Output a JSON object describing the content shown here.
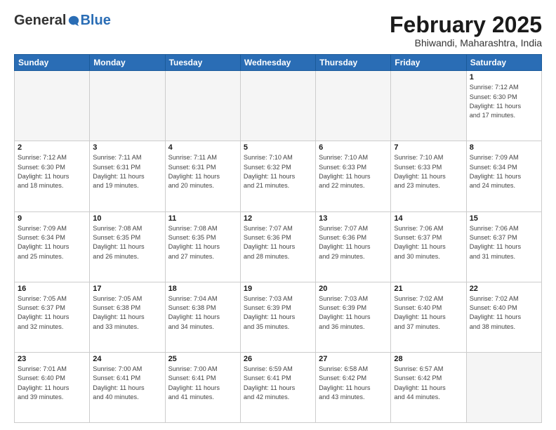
{
  "header": {
    "logo_general": "General",
    "logo_blue": "Blue",
    "title": "February 2025",
    "subtitle": "Bhiwandi, Maharashtra, India"
  },
  "weekdays": [
    "Sunday",
    "Monday",
    "Tuesday",
    "Wednesday",
    "Thursday",
    "Friday",
    "Saturday"
  ],
  "weeks": [
    [
      {
        "day": "",
        "info": ""
      },
      {
        "day": "",
        "info": ""
      },
      {
        "day": "",
        "info": ""
      },
      {
        "day": "",
        "info": ""
      },
      {
        "day": "",
        "info": ""
      },
      {
        "day": "",
        "info": ""
      },
      {
        "day": "1",
        "info": "Sunrise: 7:12 AM\nSunset: 6:30 PM\nDaylight: 11 hours\nand 17 minutes."
      }
    ],
    [
      {
        "day": "2",
        "info": "Sunrise: 7:12 AM\nSunset: 6:30 PM\nDaylight: 11 hours\nand 18 minutes."
      },
      {
        "day": "3",
        "info": "Sunrise: 7:11 AM\nSunset: 6:31 PM\nDaylight: 11 hours\nand 19 minutes."
      },
      {
        "day": "4",
        "info": "Sunrise: 7:11 AM\nSunset: 6:31 PM\nDaylight: 11 hours\nand 20 minutes."
      },
      {
        "day": "5",
        "info": "Sunrise: 7:10 AM\nSunset: 6:32 PM\nDaylight: 11 hours\nand 21 minutes."
      },
      {
        "day": "6",
        "info": "Sunrise: 7:10 AM\nSunset: 6:33 PM\nDaylight: 11 hours\nand 22 minutes."
      },
      {
        "day": "7",
        "info": "Sunrise: 7:10 AM\nSunset: 6:33 PM\nDaylight: 11 hours\nand 23 minutes."
      },
      {
        "day": "8",
        "info": "Sunrise: 7:09 AM\nSunset: 6:34 PM\nDaylight: 11 hours\nand 24 minutes."
      }
    ],
    [
      {
        "day": "9",
        "info": "Sunrise: 7:09 AM\nSunset: 6:34 PM\nDaylight: 11 hours\nand 25 minutes."
      },
      {
        "day": "10",
        "info": "Sunrise: 7:08 AM\nSunset: 6:35 PM\nDaylight: 11 hours\nand 26 minutes."
      },
      {
        "day": "11",
        "info": "Sunrise: 7:08 AM\nSunset: 6:35 PM\nDaylight: 11 hours\nand 27 minutes."
      },
      {
        "day": "12",
        "info": "Sunrise: 7:07 AM\nSunset: 6:36 PM\nDaylight: 11 hours\nand 28 minutes."
      },
      {
        "day": "13",
        "info": "Sunrise: 7:07 AM\nSunset: 6:36 PM\nDaylight: 11 hours\nand 29 minutes."
      },
      {
        "day": "14",
        "info": "Sunrise: 7:06 AM\nSunset: 6:37 PM\nDaylight: 11 hours\nand 30 minutes."
      },
      {
        "day": "15",
        "info": "Sunrise: 7:06 AM\nSunset: 6:37 PM\nDaylight: 11 hours\nand 31 minutes."
      }
    ],
    [
      {
        "day": "16",
        "info": "Sunrise: 7:05 AM\nSunset: 6:37 PM\nDaylight: 11 hours\nand 32 minutes."
      },
      {
        "day": "17",
        "info": "Sunrise: 7:05 AM\nSunset: 6:38 PM\nDaylight: 11 hours\nand 33 minutes."
      },
      {
        "day": "18",
        "info": "Sunrise: 7:04 AM\nSunset: 6:38 PM\nDaylight: 11 hours\nand 34 minutes."
      },
      {
        "day": "19",
        "info": "Sunrise: 7:03 AM\nSunset: 6:39 PM\nDaylight: 11 hours\nand 35 minutes."
      },
      {
        "day": "20",
        "info": "Sunrise: 7:03 AM\nSunset: 6:39 PM\nDaylight: 11 hours\nand 36 minutes."
      },
      {
        "day": "21",
        "info": "Sunrise: 7:02 AM\nSunset: 6:40 PM\nDaylight: 11 hours\nand 37 minutes."
      },
      {
        "day": "22",
        "info": "Sunrise: 7:02 AM\nSunset: 6:40 PM\nDaylight: 11 hours\nand 38 minutes."
      }
    ],
    [
      {
        "day": "23",
        "info": "Sunrise: 7:01 AM\nSunset: 6:40 PM\nDaylight: 11 hours\nand 39 minutes."
      },
      {
        "day": "24",
        "info": "Sunrise: 7:00 AM\nSunset: 6:41 PM\nDaylight: 11 hours\nand 40 minutes."
      },
      {
        "day": "25",
        "info": "Sunrise: 7:00 AM\nSunset: 6:41 PM\nDaylight: 11 hours\nand 41 minutes."
      },
      {
        "day": "26",
        "info": "Sunrise: 6:59 AM\nSunset: 6:41 PM\nDaylight: 11 hours\nand 42 minutes."
      },
      {
        "day": "27",
        "info": "Sunrise: 6:58 AM\nSunset: 6:42 PM\nDaylight: 11 hours\nand 43 minutes."
      },
      {
        "day": "28",
        "info": "Sunrise: 6:57 AM\nSunset: 6:42 PM\nDaylight: 11 hours\nand 44 minutes."
      },
      {
        "day": "",
        "info": ""
      }
    ]
  ]
}
